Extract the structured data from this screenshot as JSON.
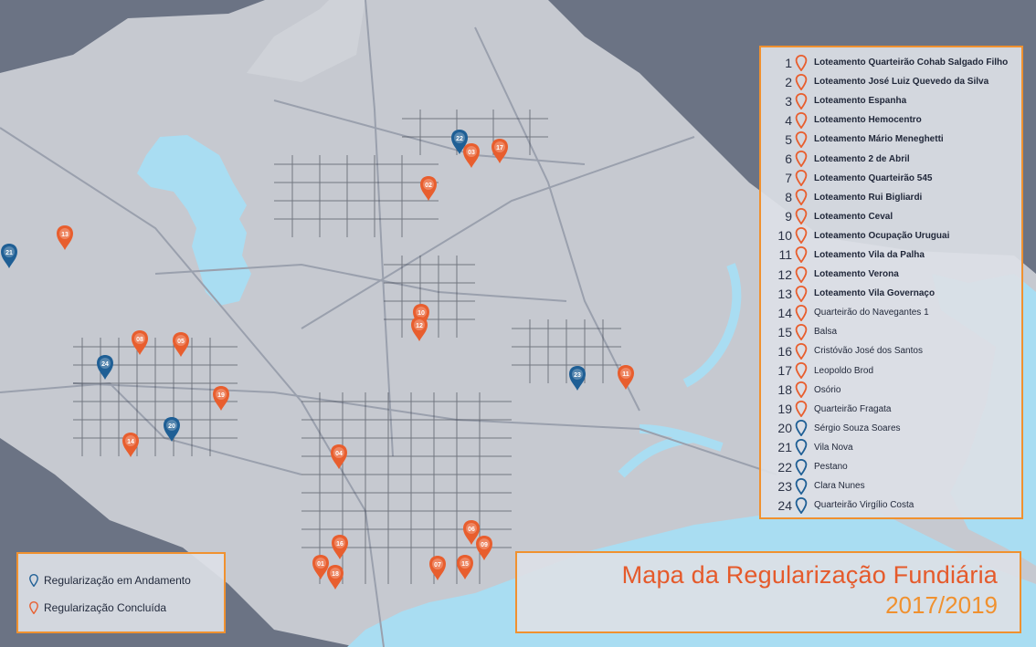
{
  "map": {
    "colors": {
      "background": "#6b7384",
      "land": "#c6c9d0",
      "water": "#a9ddf2",
      "ongoing": "#1f5f95",
      "completed": "#e85e2e",
      "accent_border": "#f0912f"
    },
    "markers": [
      {
        "label": "21",
        "status": "ongoing"
      },
      {
        "label": "13",
        "status": "completed"
      },
      {
        "label": "22",
        "status": "ongoing"
      },
      {
        "label": "03",
        "status": "completed"
      },
      {
        "label": "17",
        "status": "completed"
      },
      {
        "label": "02",
        "status": "completed"
      },
      {
        "label": "10",
        "status": "completed"
      },
      {
        "label": "12",
        "status": "completed"
      },
      {
        "label": "08",
        "status": "completed"
      },
      {
        "label": "05",
        "status": "completed"
      },
      {
        "label": "24",
        "status": "ongoing"
      },
      {
        "label": "19",
        "status": "completed"
      },
      {
        "label": "20",
        "status": "ongoing"
      },
      {
        "label": "23",
        "status": "ongoing"
      },
      {
        "label": "11",
        "status": "completed"
      },
      {
        "label": "04",
        "status": "completed"
      },
      {
        "label": "14",
        "status": "completed"
      },
      {
        "label": "06",
        "status": "completed"
      },
      {
        "label": "16",
        "status": "completed"
      },
      {
        "label": "09",
        "status": "completed"
      },
      {
        "label": "18",
        "status": "completed"
      },
      {
        "label": "07",
        "status": "completed"
      },
      {
        "label": "15",
        "status": "completed"
      },
      {
        "label": "01",
        "status": "completed"
      }
    ]
  },
  "index": {
    "items": [
      {
        "num": "1",
        "label": "Loteamento Quarteirão Cohab Salgado Filho",
        "status": "completed",
        "bold": true
      },
      {
        "num": "2",
        "label": "Loteamento José Luiz Quevedo da Silva",
        "status": "completed",
        "bold": true
      },
      {
        "num": "3",
        "label": "Loteamento Espanha",
        "status": "completed",
        "bold": true
      },
      {
        "num": "4",
        "label": "Loteamento Hemocentro",
        "status": "completed",
        "bold": true
      },
      {
        "num": "5",
        "label": "Loteamento Mário Meneghetti",
        "status": "completed",
        "bold": true
      },
      {
        "num": "6",
        "label": "Loteamento 2 de Abril",
        "status": "completed",
        "bold": true
      },
      {
        "num": "7",
        "label": "Loteamento Quarteirão 545",
        "status": "completed",
        "bold": true
      },
      {
        "num": "8",
        "label": "Loteamento Rui Bigliardi",
        "status": "completed",
        "bold": true
      },
      {
        "num": "9",
        "label": "Loteamento Ceval",
        "status": "completed",
        "bold": true
      },
      {
        "num": "10",
        "label": "Loteamento Ocupação Uruguai",
        "status": "completed",
        "bold": true
      },
      {
        "num": "11",
        "label": "Loteamento Vila da Palha",
        "status": "completed",
        "bold": true
      },
      {
        "num": "12",
        "label": "Loteamento Verona",
        "status": "completed",
        "bold": true
      },
      {
        "num": "13",
        "label": "Loteamento Vila Governaço",
        "status": "completed",
        "bold": true
      },
      {
        "num": "14",
        "label": "Quarteirão do Navegantes 1",
        "status": "completed",
        "bold": false
      },
      {
        "num": "15",
        "label": "Balsa",
        "status": "completed",
        "bold": false
      },
      {
        "num": "16",
        "label": "Cristóvão José dos Santos",
        "status": "completed",
        "bold": false
      },
      {
        "num": "17",
        "label": "Leopoldo Brod",
        "status": "completed",
        "bold": false
      },
      {
        "num": "18",
        "label": "Osório",
        "status": "completed",
        "bold": false
      },
      {
        "num": "19",
        "label": "Quarteirão Fragata",
        "status": "completed",
        "bold": false
      },
      {
        "num": "20",
        "label": "Sérgio Souza Soares",
        "status": "ongoing",
        "bold": false
      },
      {
        "num": "21",
        "label": "Vila Nova",
        "status": "ongoing",
        "bold": false
      },
      {
        "num": "22",
        "label": "Pestano",
        "status": "ongoing",
        "bold": false
      },
      {
        "num": "23",
        "label": "Clara Nunes",
        "status": "ongoing",
        "bold": false
      },
      {
        "num": "24",
        "label": "Quarteirão Virgílio Costa",
        "status": "ongoing",
        "bold": false
      }
    ]
  },
  "legend": {
    "ongoing_label": "Regularização em Andamento",
    "completed_label": "Regularização Concluída"
  },
  "title": {
    "main": "Mapa da Regularização Fundiária",
    "years": "2017/2019"
  }
}
